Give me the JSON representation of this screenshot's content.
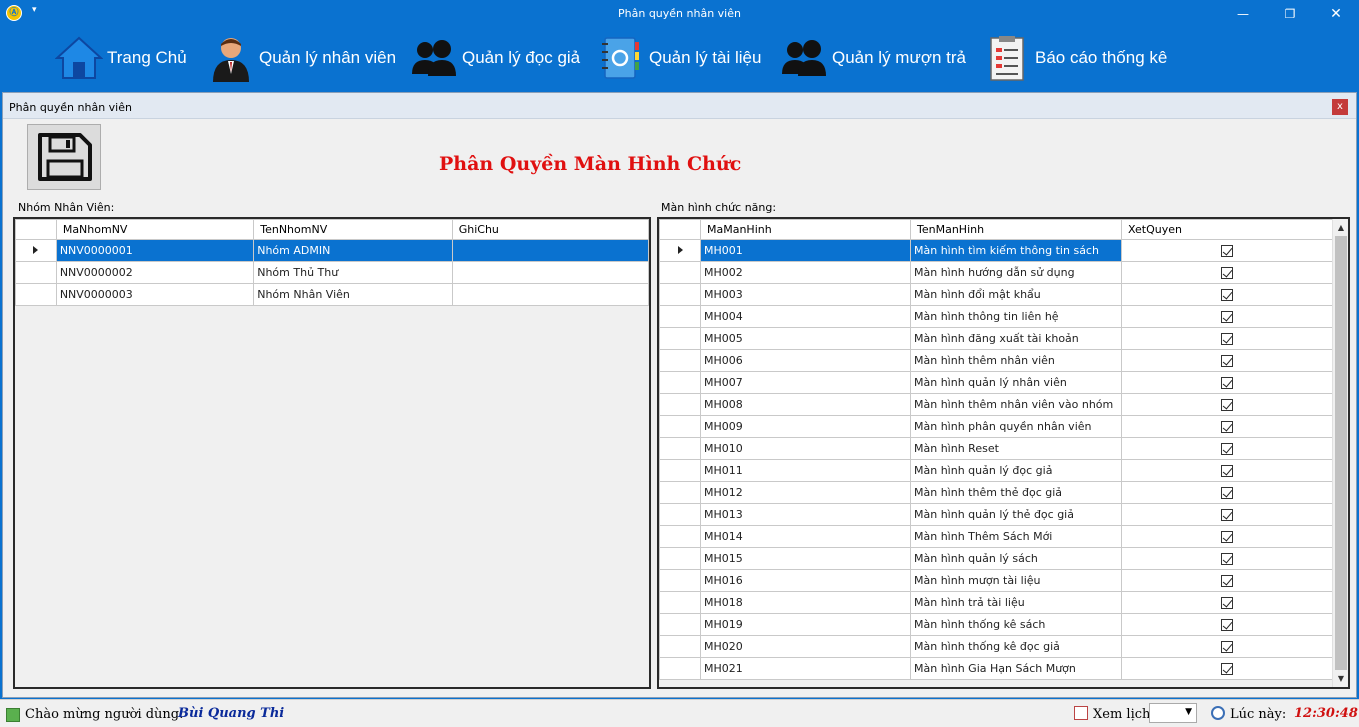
{
  "window": {
    "app_icon": "Ⓐ",
    "quick_access": "▾",
    "title": "Phân quyền nhân viên",
    "minimize": "—",
    "maximize": "❐",
    "close": "✕"
  },
  "nav": [
    {
      "label": "Trang Chủ",
      "icon": "home-icon"
    },
    {
      "label": "Quản lý nhân viên",
      "icon": "employee-icon"
    },
    {
      "label": "Quản lý đọc giả",
      "icon": "readers-icon"
    },
    {
      "label": "Quản lý tài liệu",
      "icon": "address-book-icon"
    },
    {
      "label": "Quản lý mượn trả",
      "icon": "borrow-return-icon"
    },
    {
      "label": "Báo cáo thống kê",
      "icon": "report-icon"
    }
  ],
  "child": {
    "title": "Phân quyền nhân viên",
    "close": "x",
    "heading": "Phân Quyền Màn Hình Chức"
  },
  "left_group": {
    "label": "Nhóm Nhân Viên:",
    "columns": [
      "MaNhomNV",
      "TenNhomNV",
      "GhiChu"
    ],
    "rows": [
      {
        "ma": "NNV0000001",
        "ten": "Nhóm ADMIN",
        "ghichu": "",
        "selected": true
      },
      {
        "ma": "NNV0000002",
        "ten": "Nhóm Thủ Thư",
        "ghichu": "",
        "selected": false
      },
      {
        "ma": "NNV0000003",
        "ten": "Nhóm Nhân Viên",
        "ghichu": "",
        "selected": false
      }
    ]
  },
  "right_group": {
    "label": "Màn hình chức năng:",
    "columns": [
      "MaManHinh",
      "TenManHinh",
      "XetQuyen"
    ],
    "rows": [
      {
        "ma": "MH001",
        "ten": "Màn hình tìm kiếm thông tin sách",
        "checked": true,
        "selected": true
      },
      {
        "ma": "MH002",
        "ten": "Màn hình hướng dẫn sử dụng",
        "checked": true
      },
      {
        "ma": "MH003",
        "ten": "Màn hình đổi mật khẩu",
        "checked": true
      },
      {
        "ma": "MH004",
        "ten": "Màn hình thông tin liên hệ",
        "checked": true
      },
      {
        "ma": "MH005",
        "ten": "Màn hình đăng xuất tài khoản",
        "checked": true
      },
      {
        "ma": "MH006",
        "ten": "Màn hình thêm nhân viên",
        "checked": true
      },
      {
        "ma": "MH007",
        "ten": "Màn hình quản lý nhân viên",
        "checked": true
      },
      {
        "ma": "MH008",
        "ten": "Màn hình thêm nhân viên vào nhóm",
        "checked": true
      },
      {
        "ma": "MH009",
        "ten": "Màn hình phân quyền nhân viên",
        "checked": true
      },
      {
        "ma": "MH010",
        "ten": "Màn hình Reset",
        "checked": true
      },
      {
        "ma": "MH011",
        "ten": "Màn hình quản lý đọc giả",
        "checked": true
      },
      {
        "ma": "MH012",
        "ten": "Màn hình thêm thẻ đọc giả",
        "checked": true
      },
      {
        "ma": "MH013",
        "ten": "Màn hình quản lý thẻ đọc giả",
        "checked": true
      },
      {
        "ma": "MH014",
        "ten": "Màn hình Thêm Sách Mới",
        "checked": true
      },
      {
        "ma": "MH015",
        "ten": "Màn hình quản lý sách",
        "checked": true
      },
      {
        "ma": "MH016",
        "ten": "Màn hình mượn tài liệu",
        "checked": true
      },
      {
        "ma": "MH018",
        "ten": "Màn hình trả tài liệu",
        "checked": true
      },
      {
        "ma": "MH019",
        "ten": "Màn hình thống kê sách",
        "checked": true
      },
      {
        "ma": "MH020",
        "ten": "Màn hình thống kê đọc giả",
        "checked": true
      },
      {
        "ma": "MH021",
        "ten": "Màn hình Gia Hạn Sách Mượn",
        "checked": true
      }
    ]
  },
  "status": {
    "welcome": "Chào mừng người dùng:",
    "user": "Bùi Quang Thi",
    "calendar_label": "Xem lịch",
    "calendar_value": "",
    "clock_label": "Lúc này:",
    "time": "12:30:48"
  },
  "colors": {
    "accent": "#0a72d0",
    "heading": "#e01010",
    "user": "#0a2a9a",
    "time": "#d01010"
  }
}
